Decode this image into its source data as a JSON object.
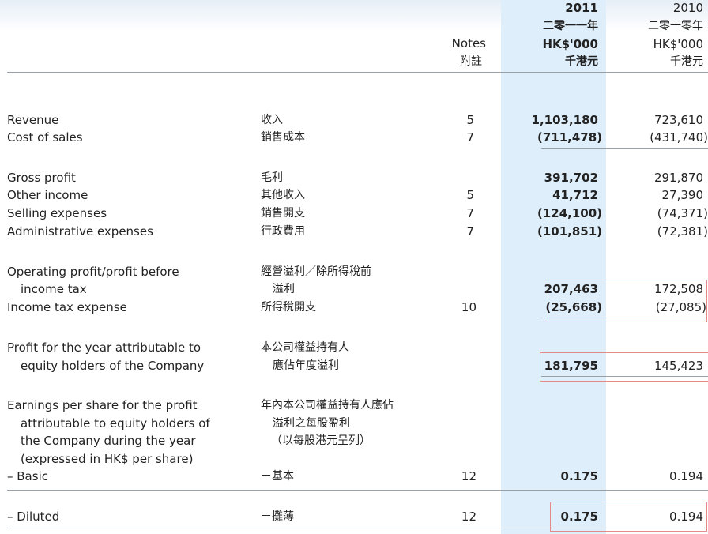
{
  "header": {
    "notes_en": "Notes",
    "notes_zh": "附註",
    "cur_year": "2011",
    "cur_year_zh": "二零一一年",
    "cur_unit": "HK$'000",
    "cur_unit_zh": "千港元",
    "prev_year": "2010",
    "prev_year_zh": "二零一零年",
    "prev_unit": "HK$'000",
    "prev_unit_zh": "千港元"
  },
  "rows": {
    "revenue": {
      "en": "Revenue",
      "zh": "收入",
      "note": "5",
      "cur": "1,103,180",
      "prev": "723,610"
    },
    "cost_of_sales": {
      "en": "Cost of sales",
      "zh": "銷售成本",
      "note": "7",
      "cur": "(711,478)",
      "prev": "(431,740)"
    },
    "gross_profit": {
      "en": "Gross profit",
      "zh": "毛利",
      "cur": "391,702",
      "prev": "291,870"
    },
    "other_income": {
      "en": "Other income",
      "zh": "其他收入",
      "note": "5",
      "cur": "41,712",
      "prev": "27,390"
    },
    "selling": {
      "en": "Selling expenses",
      "zh": "銷售開支",
      "note": "7",
      "cur": "(124,100)",
      "prev": "(74,371)"
    },
    "admin": {
      "en": "Administrative expenses",
      "zh": "行政費用",
      "note": "7",
      "cur": "(101,851)",
      "prev": "(72,381)"
    },
    "operating": {
      "en1": "Operating profit/profit before",
      "en2": "income tax",
      "zh1": "經營溢利／除所得稅前",
      "zh2": "溢利",
      "cur": "207,463",
      "prev": "172,508"
    },
    "tax": {
      "en": "Income tax expense",
      "zh": "所得稅開支",
      "note": "10",
      "cur": "(25,668)",
      "prev": "(27,085)"
    },
    "profit": {
      "en1": "Profit for the year attributable to",
      "en2": "equity holders of the Company",
      "zh1": "本公司權益持有人",
      "zh2": "應佔年度溢利",
      "cur": "181,795",
      "prev": "145,423"
    },
    "eps": {
      "en1": "Earnings per share for the profit",
      "en2": "attributable to equity holders of",
      "en3": "the Company during the year",
      "en4": "(expressed in HK$ per share)",
      "zh1": "年內本公司權益持有人應佔",
      "zh2": "溢利之每股盈利",
      "zh3": "（以每股港元呈列）"
    },
    "basic": {
      "en": "– Basic",
      "zh": "－基本",
      "note": "12",
      "cur": "0.175",
      "prev": "0.194"
    },
    "diluted": {
      "en": "– Diluted",
      "zh": "－攤薄",
      "note": "12",
      "cur": "0.175",
      "prev": "0.194"
    }
  }
}
